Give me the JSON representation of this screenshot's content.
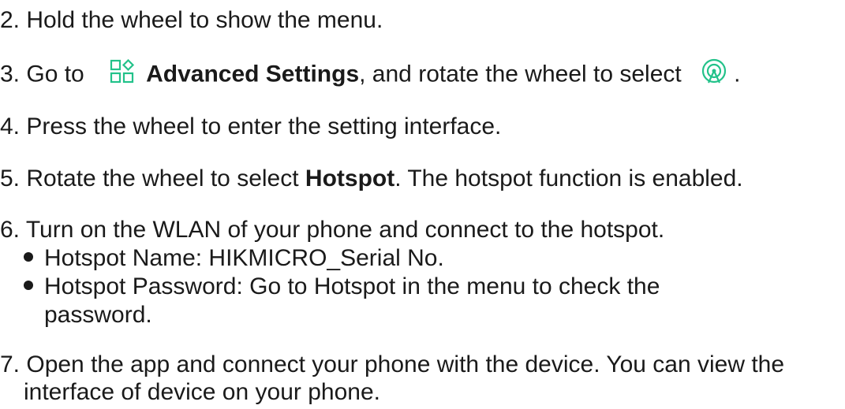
{
  "steps": {
    "s2": {
      "text": "2. Hold the wheel to show the menu."
    },
    "s3": {
      "prefix": "3. Go to",
      "icon1": "advanced-settings-grid-icon",
      "bold": "Advanced Settings",
      "middle": ", and rotate the wheel to select",
      "icon2": "hotspot-icon",
      "suffix": "."
    },
    "s4": {
      "text": "4. Press the wheel to enter the setting interface."
    },
    "s5": {
      "prefix": "5. Rotate the wheel to select ",
      "bold": "Hotspot",
      "suffix": ". The hotspot function is enabled."
    },
    "s6": {
      "text": "6. Turn on the WLAN of your phone and connect to the hotspot.",
      "bullets": [
        "Hotspot Name: HIKMICRO_Serial No.",
        "Hotspot Password: Go to Hotspot in the menu to check the",
        "password."
      ]
    },
    "s7": {
      "line1": "7. Open the app and connect your phone with the device. You can view the",
      "line2": "interface of device on your phone."
    }
  },
  "colors": {
    "accent": "#23c28a",
    "text": "#1a1a1a"
  }
}
